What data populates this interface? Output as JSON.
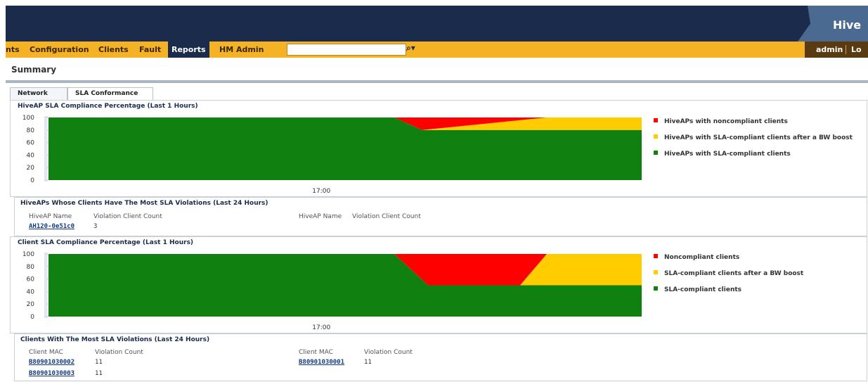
{
  "header": {
    "brand": "Hive"
  },
  "nav": {
    "items": [
      {
        "label": "nts"
      },
      {
        "label": "Configuration"
      },
      {
        "label": "Clients"
      },
      {
        "label": "Fault"
      },
      {
        "label": "Reports",
        "active": true
      },
      {
        "label": "HM Admin"
      }
    ],
    "search_icon": "search-icon",
    "user": "admin",
    "logout": "Lo"
  },
  "page": {
    "title": "Summary"
  },
  "tabs": [
    {
      "label": "Network"
    },
    {
      "label": "SLA Conformance",
      "selected": true
    }
  ],
  "colors": {
    "noncompliant": "#ff0000",
    "boost": "#ffcc00",
    "compliant": "#108010",
    "nav_bg": "#f4b224",
    "header_bg": "#1b2b4b"
  },
  "hiveap_chart": {
    "title": "HiveAP SLA Compliance Percentage (Last 1 Hours)",
    "legend": [
      {
        "label": "HiveAPs with noncompliant clients",
        "color": "#ff0000"
      },
      {
        "label": "HiveAPs with SLA-compliant clients after a BW boost",
        "color": "#ffcc00"
      },
      {
        "label": "HiveAPs with SLA-compliant clients",
        "color": "#108010"
      }
    ]
  },
  "hiveap_table": {
    "title": "HiveAPs Whose Clients Have The Most SLA Violations (Last 24 Hours)",
    "col1": "HiveAP Name",
    "col2": "Violation Client Count",
    "rows": [
      {
        "name": "AH120-0e51c0",
        "count": "3"
      }
    ]
  },
  "client_chart": {
    "title": "Client SLA Compliance Percentage (Last 1 Hours)",
    "legend": [
      {
        "label": "Noncompliant clients",
        "color": "#ff0000"
      },
      {
        "label": "SLA-compliant clients after a BW boost",
        "color": "#ffcc00"
      },
      {
        "label": "SLA-compliant clients",
        "color": "#108010"
      }
    ]
  },
  "client_table": {
    "title": "Clients With The Most SLA Violations (Last 24 Hours)",
    "col1": "Client MAC",
    "col2": "Violation Count",
    "left_rows": [
      {
        "mac": "B80901030002",
        "count": "11"
      },
      {
        "mac": "B80901030003",
        "count": "11"
      }
    ],
    "right_rows": [
      {
        "mac": "B80901030001",
        "count": "11"
      }
    ]
  },
  "chart_data": [
    {
      "type": "area",
      "title": "HiveAP SLA Compliance Percentage (Last 1 Hours)",
      "ylim": [
        0,
        100
      ],
      "yticks": [
        "0",
        "20",
        "40",
        "60",
        "80",
        "100"
      ],
      "xtick_label": "17:00",
      "x": [
        0,
        0.583,
        0.63,
        0.84,
        1.0
      ],
      "series": [
        {
          "name": "HiveAPs with SLA-compliant clients",
          "values": [
            100,
            100,
            80,
            80,
            80
          ]
        },
        {
          "name": "HiveAPs with SLA-compliant clients after a BW boost",
          "values": [
            0,
            0,
            0,
            20,
            20
          ]
        },
        {
          "name": "HiveAPs with noncompliant clients",
          "values": [
            0,
            0,
            20,
            0,
            0
          ]
        }
      ]
    },
    {
      "type": "area",
      "title": "Client SLA Compliance Percentage (Last 1 Hours)",
      "ylim": [
        0,
        100
      ],
      "yticks": [
        "0",
        "20",
        "40",
        "60",
        "80",
        "100"
      ],
      "xtick_label": "17:00",
      "x": [
        0,
        0.583,
        0.64,
        0.795,
        0.84,
        1.0
      ],
      "series": [
        {
          "name": "SLA-compliant clients",
          "values": [
            100,
            100,
            50,
            50,
            50,
            50
          ]
        },
        {
          "name": "SLA-compliant clients after a BW boost",
          "values": [
            0,
            0,
            0,
            0,
            50,
            50
          ]
        },
        {
          "name": "Noncompliant clients",
          "values": [
            0,
            0,
            50,
            50,
            0,
            0
          ]
        }
      ]
    }
  ]
}
